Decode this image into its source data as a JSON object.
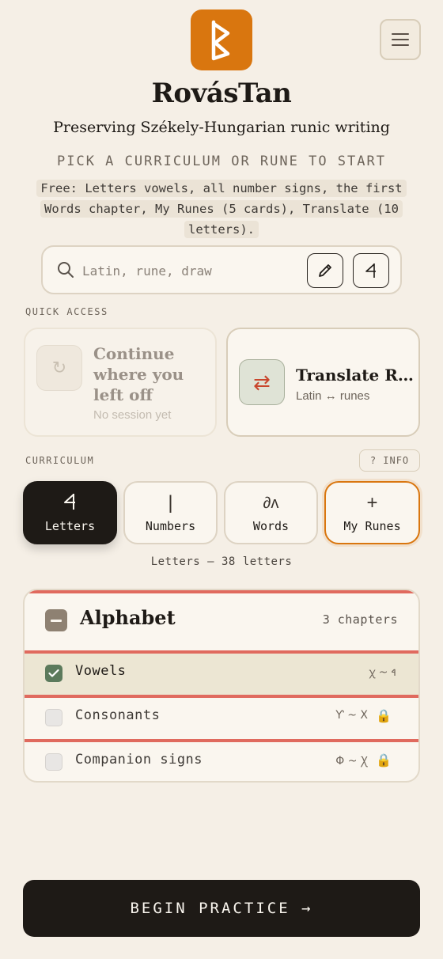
{
  "brand": {
    "title": "RovásTan",
    "subtitle": "Preserving Székely-Hungarian runic writing",
    "accent_color": "#d9760f"
  },
  "header": {
    "logo_icon": "rune-logo-icon",
    "menu_icon": "hamburger-menu-icon"
  },
  "intro": {
    "pick_label": "PICK A CURRICULUM OR RUNE TO START",
    "free_note": "Free: Letters vowels, all number signs, the first Words chapter, My Runes (5 cards), Translate (10 letters)."
  },
  "search": {
    "placeholder": "Latin, rune, draw",
    "value": "",
    "draw_icon": "pencil-icon",
    "rune_button_glyph": "𐳀"
  },
  "quick_access": {
    "label": "QUICK ACCESS",
    "continue": {
      "icon": "↻",
      "title": "Continue where you left off",
      "subtitle": "No session yet"
    },
    "translate": {
      "icon": "⇄",
      "title": "Translate Runes",
      "subtitle": "Latin ↔ runes"
    }
  },
  "curriculum": {
    "label": "CURRICULUM",
    "info_label": "? INFO",
    "tabs": [
      {
        "glyph": "𐳀",
        "label": "Letters",
        "active": true
      },
      {
        "glyph": "|",
        "label": "Numbers",
        "active": false
      },
      {
        "glyph": "∂ʌ",
        "label": "Words",
        "active": false
      },
      {
        "glyph": "+",
        "label": "My Runes",
        "active": false
      }
    ],
    "caption": "Letters — 38 letters"
  },
  "alphabet": {
    "title": "Alphabet",
    "count": "3 chapters",
    "chapters": [
      {
        "label": "Vowels",
        "range": "ꭓ ~ 𐳀",
        "checked": true,
        "locked": false
      },
      {
        "label": "Consonants",
        "range": "Ƴ ~ X",
        "checked": false,
        "locked": true
      },
      {
        "label": "Companion signs",
        "range": "Φ ~ Ꭓ",
        "checked": false,
        "locked": true
      }
    ]
  },
  "begin_button": "BEGIN PRACTICE →"
}
